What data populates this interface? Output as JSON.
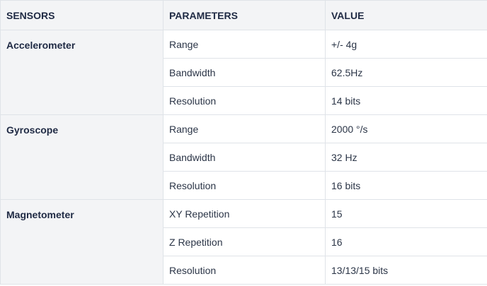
{
  "table": {
    "headers": {
      "sensors": "SENSORS",
      "parameters": "PARAMETERS",
      "value": "VALUE"
    },
    "groups": [
      {
        "sensor": "Accelerometer",
        "rows": [
          {
            "parameter": "Range",
            "value": "+/- 4g"
          },
          {
            "parameter": "Bandwidth",
            "value": "62.5Hz"
          },
          {
            "parameter": "Resolution",
            "value": "14 bits"
          }
        ]
      },
      {
        "sensor": "Gyroscope",
        "rows": [
          {
            "parameter": "Range",
            "value": "2000 °/s"
          },
          {
            "parameter": "Bandwidth",
            "value": "32 Hz"
          },
          {
            "parameter": "Resolution",
            "value": "16 bits"
          }
        ]
      },
      {
        "sensor": "Magnetometer",
        "rows": [
          {
            "parameter": "XY Repetition",
            "value": "15"
          },
          {
            "parameter": "Z Repetition",
            "value": "16"
          },
          {
            "parameter": "Resolution",
            "value": "13/13/15 bits"
          }
        ]
      }
    ]
  }
}
